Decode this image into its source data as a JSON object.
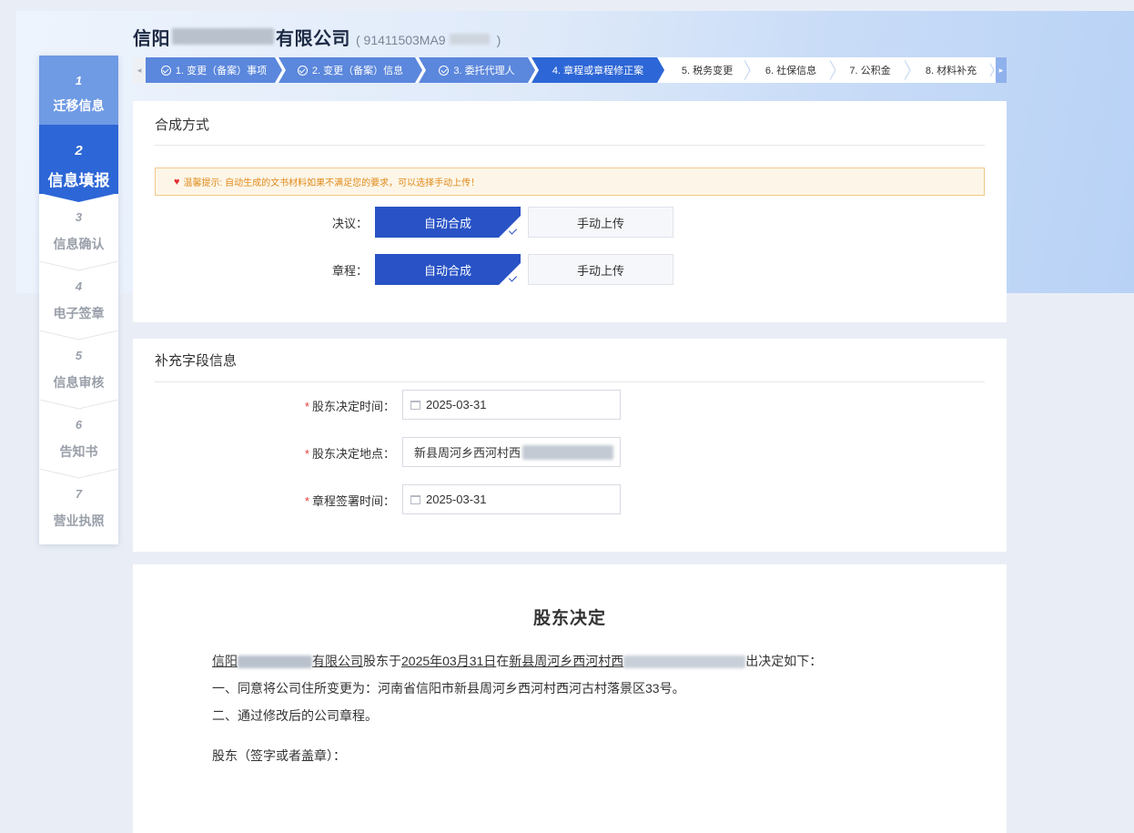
{
  "header": {
    "company_prefix": "信阳",
    "company_suffix": "有限公司",
    "credit_open": "( 91411503MA9",
    "credit_close": ")"
  },
  "sidebar": {
    "steps": [
      {
        "num": "1",
        "label": "迁移信息"
      },
      {
        "num": "2",
        "label": "信息填报"
      },
      {
        "num": "3",
        "label": "信息确认"
      },
      {
        "num": "4",
        "label": "电子签章"
      },
      {
        "num": "5",
        "label": "信息审核"
      },
      {
        "num": "6",
        "label": "告知书"
      },
      {
        "num": "7",
        "label": "营业执照"
      }
    ]
  },
  "topbar": {
    "left_arrow": "◂",
    "right_arrow": "▸",
    "steps": [
      {
        "label": "1. 变更（备案）事项"
      },
      {
        "label": "2. 变更（备案）信息"
      },
      {
        "label": "3. 委托代理人"
      },
      {
        "label": "4. 章程或章程修正案"
      },
      {
        "label": "5. 税务变更"
      },
      {
        "label": "6. 社保信息"
      },
      {
        "label": "7. 公积金"
      },
      {
        "label": "8. 材料补充"
      }
    ]
  },
  "compose": {
    "title": "合成方式",
    "notice": "温馨提示: 自动生成的文书材料如果不满足您的要求，可以选择手动上传！",
    "resolution_label": "决议：",
    "charter_label": "章程：",
    "auto_label": "自动合成",
    "manual_label": "手动上传"
  },
  "supplement": {
    "title": "补充字段信息",
    "fields": [
      {
        "label": "股东决定时间：",
        "value": "2025-03-31"
      },
      {
        "label": "股东决定地点：",
        "value": "新县周河乡西河村西"
      },
      {
        "label": "章程签署时间：",
        "value": "2025-03-31"
      }
    ]
  },
  "document": {
    "title": "股东决定",
    "l1_company_a": "信阳",
    "l1_company_b": "有限公司",
    "l1_text1": "股东于",
    "l1_date": "2025年03月31日",
    "l1_text2": "在",
    "l1_place": "新县周河乡西河村西",
    "l1_text3": "出决定如下：",
    "line2": "一、同意将公司住所变更为：河南省信阳市新县周河乡西河村西河古村落景区33号。",
    "line3": "二、通过修改后的公司章程。",
    "line4": "股东（签字或者盖章）："
  },
  "colors": {
    "primary": "#2d66d6",
    "done": "#5b87dc",
    "selected_option": "#2852c5",
    "notice_text": "#e08a1a"
  }
}
